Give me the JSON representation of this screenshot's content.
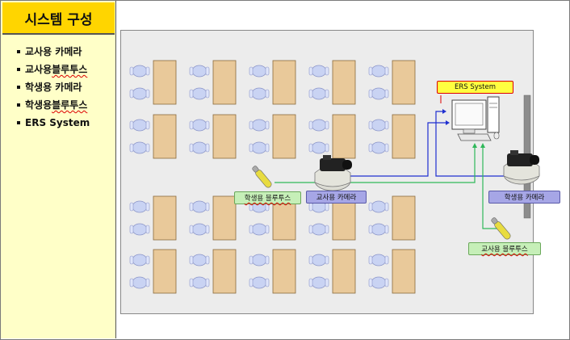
{
  "sidebar": {
    "title": "시스템 구성",
    "items": [
      {
        "label": "교사용 카메라"
      },
      {
        "prefix": "교사용 ",
        "squiggle": "블루투스"
      },
      {
        "label": "학생용 카메라"
      },
      {
        "prefix": "학생용 ",
        "squiggle": "블루투스"
      },
      {
        "label": "ERS System"
      }
    ]
  },
  "diagram": {
    "ers_system_label": "ERS System",
    "student_bluetooth_label": "학생용 블루투스",
    "teacher_camera_label": "교사용 카메라",
    "student_camera_label": "학생용 카메라",
    "teacher_bluetooth_label": "교사용 블루투스",
    "colors": {
      "room_bg": "#ececec",
      "desk": "#e9c99a",
      "chair": "#c9d3f3",
      "link_blue": "#1f2fd0",
      "link_green": "#2fb85a",
      "title_bg": "#ffd500",
      "sidebar_bg": "#ffffc8"
    }
  }
}
